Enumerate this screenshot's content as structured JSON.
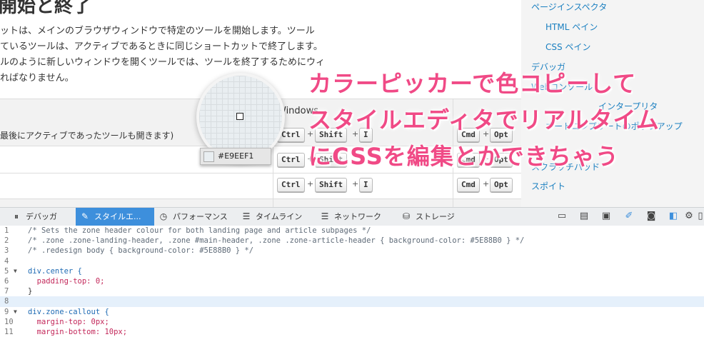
{
  "page": {
    "title": "開始と終了",
    "paragraph": [
      "ットは、メインのブラウザウィンドウで特定のツールを開始します。ツール",
      "ているツールは、アクティブであるときに同じショートカットで終了します。",
      "ルのように新しいウィンドウを開くツールでは、ツールを終了するためにウィ",
      "ればなりません。"
    ]
  },
  "sidebar": {
    "items": [
      {
        "label": "ページインスペクタ"
      },
      {
        "label": "HTML ペイン"
      },
      {
        "label": "CSS ペイン"
      },
      {
        "label": "デバッガ"
      },
      {
        "label": "Webコンソール"
      },
      {
        "label": "スクラッチパッド"
      },
      {
        "label": "スポイト"
      }
    ],
    "partial_a": "インタープリタ",
    "partial_b": "オートコンプリートのポップアップ"
  },
  "table": {
    "header_windows": "Windows",
    "row1_text": "最後にアクティブであったツールも開きます)",
    "keys": {
      "ctrl": "Ctrl",
      "shift": "Shift",
      "i": "I",
      "cmd": "Cmd",
      "opt": "Opt",
      "plus": "+"
    }
  },
  "color_picker": {
    "value": "#E9EEF1",
    "color": "#e9eef1"
  },
  "overlay": {
    "line1": "カラーピッカーで色コピーして",
    "line2": "スタイルエディタでリアルタイム",
    "line3": "にCSSを編集とかできちゃう",
    "color": "#f04a86"
  },
  "toolbar": {
    "tabs": [
      {
        "label": "デバッガ",
        "icon": "pause-icon"
      },
      {
        "label": "スタイルエ...",
        "icon": "pencil-icon",
        "active": true
      },
      {
        "label": "パフォーマンス",
        "icon": "gauge-icon"
      },
      {
        "label": "タイムライン",
        "icon": "timeline-icon"
      },
      {
        "label": "ネットワーク",
        "icon": "network-icon"
      },
      {
        "label": "ストレージ",
        "icon": "storage-icon"
      }
    ],
    "right_icons": [
      "console-icon",
      "scratchpad-icon",
      "responsive-icon",
      "eyedropper-icon",
      "screenshot-icon",
      "split-icon",
      "gear-icon",
      "dock-icon"
    ],
    "active_color": "#3d8fdc"
  },
  "editor": {
    "lines": [
      {
        "n": "1",
        "text": "/* Sets the zone header colour for both landing page and article subpages */"
      },
      {
        "n": "2",
        "text": "/* .zone .zone-landing-header, .zone #main-header, .zone .zone-article-header { background-color: #5E88B0 } */"
      },
      {
        "n": "3",
        "text": "/* .redesign body { background-color: #5E88B0 } */"
      },
      {
        "n": "4",
        "text": ""
      },
      {
        "n": "5",
        "text": "div.center {"
      },
      {
        "n": "6",
        "text": "  padding-top: 0;"
      },
      {
        "n": "7",
        "text": "}"
      },
      {
        "n": "8",
        "text": ""
      },
      {
        "n": "9",
        "text": "div.zone-callout {"
      },
      {
        "n": "10",
        "text": "  margin-top: 0px;"
      },
      {
        "n": "11",
        "text": "  margin-bottom: 10px;"
      }
    ]
  }
}
